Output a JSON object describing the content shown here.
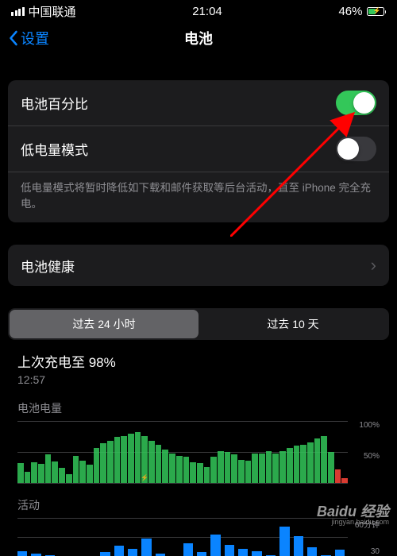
{
  "status_bar": {
    "carrier": "中国联通",
    "time": "21:04",
    "battery_percent": "46%"
  },
  "nav": {
    "back": "设置",
    "title": "电池"
  },
  "rows": {
    "battery_percentage": "电池百分比",
    "low_power_mode": "低电量模式",
    "low_power_desc": "低电量模式将暂时降低如下载和邮件获取等后台活动，直至 iPhone 完全充电。",
    "battery_health": "电池健康"
  },
  "tabs": {
    "t24h": "过去 24 小时",
    "t10d": "过去 10 天"
  },
  "last_charge": {
    "title": "上次充电至 98%",
    "time": "12:57"
  },
  "chart_data": [
    {
      "type": "bar",
      "title": "电池电量",
      "ylim": [
        0,
        100
      ],
      "ylabels": [
        "100%",
        "50%"
      ],
      "values": [
        32,
        18,
        34,
        31,
        46,
        35,
        24,
        14,
        44,
        36,
        30,
        56,
        64,
        68,
        74,
        76,
        80,
        82,
        76,
        68,
        62,
        54,
        48,
        44,
        42,
        34,
        32,
        26,
        42,
        52,
        50,
        46,
        38,
        36,
        48,
        48,
        52,
        48,
        52,
        56,
        60,
        62,
        66,
        72,
        76,
        50,
        22,
        8
      ],
      "red_bars": [
        46,
        47
      ],
      "charging_marker_index": 18
    },
    {
      "type": "bar",
      "title": "活动",
      "ylabels": [
        "60分钟",
        "30"
      ],
      "values": [
        8,
        4,
        2,
        0,
        0,
        0,
        6,
        16,
        12,
        28,
        4,
        0,
        20,
        6,
        34,
        18,
        12,
        8,
        2,
        46,
        32,
        14,
        2,
        10
      ]
    }
  ],
  "watermark": {
    "main": "Baidu 经验",
    "sub": "jingyan.baidu.com"
  }
}
